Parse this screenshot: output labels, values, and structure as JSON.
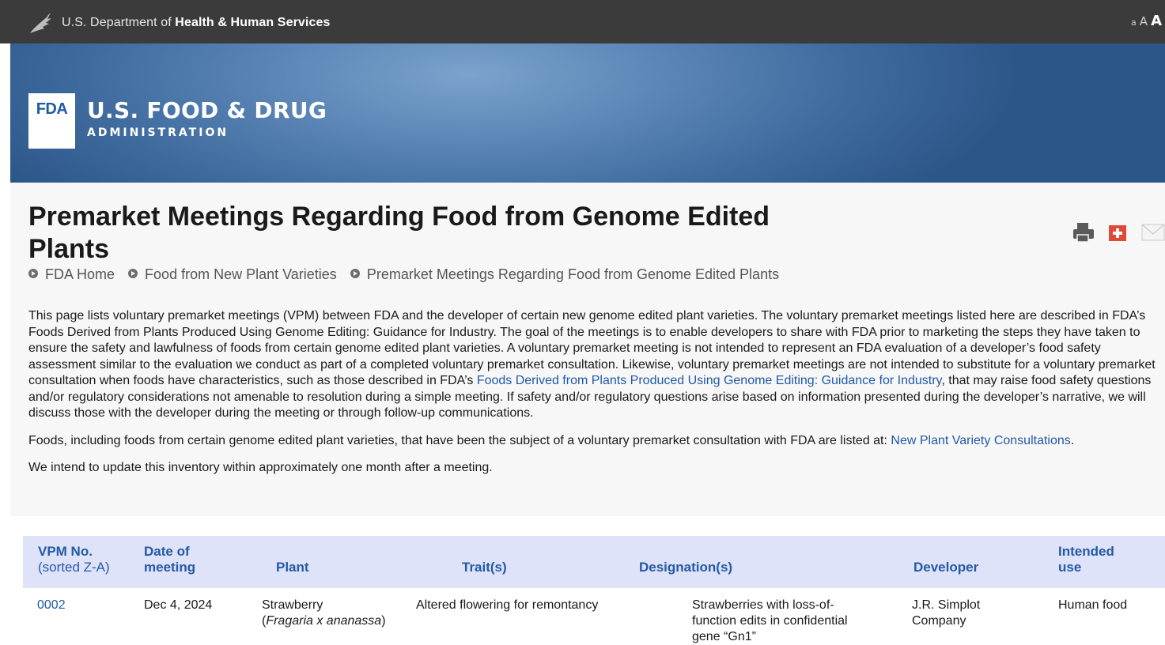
{
  "hhs": {
    "prefix": "U.S. Department of ",
    "name": "Health & Human Services",
    "text_size": {
      "small": "a",
      "medium": "A",
      "large": "A"
    }
  },
  "brand": {
    "mark": "FDA",
    "title": "U.S. FOOD & DRUG",
    "subtitle": "ADMINISTRATION"
  },
  "page": {
    "title": "Premarket Meetings Regarding Food from Genome Edited Plants",
    "breadcrumb": [
      "FDA Home",
      "Food from New Plant Varieties",
      "Premarket Meetings Regarding Food from Genome Edited Plants"
    ]
  },
  "share": {
    "print_icon": "print-icon",
    "addthis_icon": "plus-share-icon",
    "email_icon": "email-icon"
  },
  "intro": {
    "p1_a": "This page lists voluntary premarket meetings (VPM) between FDA and the developer of certain new genome edited plant varieties. The voluntary premarket meetings listed here are described in FDA’s Foods Derived from Plants Produced Using Genome Editing: Guidance for Industry. The goal of the meetings is to enable developers to share with FDA prior to marketing the steps they have taken to ensure the safety and lawfulness of foods from certain genome edited plant varieties. A voluntary premarket meeting is not intended to represent an FDA evaluation of a developer’s food safety assessment similar to the evaluation we conduct as part of a completed voluntary premarket consultation. Likewise, voluntary premarket meetings are not intended to substitute for a voluntary premarket consultation when foods have characteristics, such as those described in FDA’s ",
    "p1_link": "Foods Derived from Plants Produced Using Genome Editing: Guidance for Industry",
    "p1_b": ", that may raise food safety questions and/or regulatory considerations not amenable to resolution during a simple meeting. If safety and/or regulatory questions arise based on information presented during the developer’s narrative, we will discuss those with the developer during the meeting or through follow-up communications.",
    "p2_a": "Foods, including foods from certain genome edited plant varieties, that have been the subject of a voluntary premarket consultation with FDA are listed at: ",
    "p2_link": "New Plant Variety Consultations",
    "p2_b": ".",
    "p3": "We intend to update this inventory within approximately one month after a meeting."
  },
  "table": {
    "headers": {
      "vpm_no": "VPM No.",
      "vpm_sort": "(sorted Z-A)",
      "date_l1": "Date of",
      "date_l2": "meeting",
      "plant": "Plant",
      "traits": "Trait(s)",
      "designations": "Designation(s)",
      "developer": "Developer",
      "use_l1": "Intended",
      "use_l2": "use"
    },
    "rows": [
      {
        "vpm": "0002",
        "date": "Dec 4, 2024",
        "plant_common": "Strawberry",
        "plant_sci": "Fragaria x ananassa",
        "trait": "Altered flowering for remontancy",
        "designation": "Strawberries with loss-of-function edits in confidential gene “Gn1”",
        "developer": "J.R. Simplot Company",
        "use": "Human food"
      }
    ]
  }
}
